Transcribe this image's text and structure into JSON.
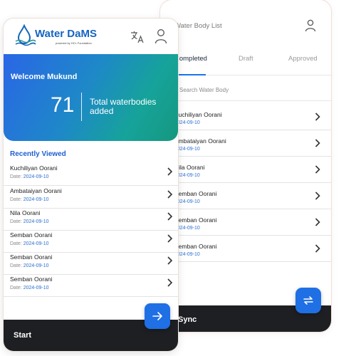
{
  "back_screen": {
    "title": "Water Body List",
    "tabs": [
      {
        "label": "Completed",
        "active": true
      },
      {
        "label": "Draft",
        "active": false
      },
      {
        "label": "Approved",
        "active": false
      }
    ],
    "search_placeholder": "Search Water Body",
    "rows": [
      {
        "name": "Kuchiliyan Oorani",
        "date": "2024-09-10"
      },
      {
        "name": "Ambataiyan Oorani",
        "date": "2024-09-10"
      },
      {
        "name": "Nila Oorani",
        "date": "2024-09-10"
      },
      {
        "name": "Semban Oorani",
        "date": "2024-09-10"
      },
      {
        "name": "Semban Oorani",
        "date": "2024-09-10"
      },
      {
        "name": "Semban Oorani",
        "date": "2024-09-10"
      }
    ],
    "footer_label": "Sync",
    "fab_icon": "sync-icon"
  },
  "front_screen": {
    "logo_title": "Water DaMS",
    "logo_subtitle": "powered by HCL Foundation",
    "welcome": "Welcome Mukund",
    "total_count": "71",
    "total_label": "Total waterbodies added",
    "recent_title": "Recently Viewed",
    "date_prefix": "Date:",
    "rows": [
      {
        "name": "Kuchiliyan Oorani",
        "date": "2024-09-10"
      },
      {
        "name": "Ambataiyan Oorani",
        "date": "2024-09-10"
      },
      {
        "name": "Nila Oorani",
        "date": "2024-09-10"
      },
      {
        "name": "Semban Oorani",
        "date": "2024-09-10"
      },
      {
        "name": "Semban Oorani",
        "date": "2024-09-10"
      },
      {
        "name": "Semban Oorani",
        "date": "2024-09-10"
      }
    ],
    "footer_label": "Start",
    "fab_icon": "arrow-right-icon"
  },
  "colors": {
    "accent": "#1f6fe5",
    "card_gradient_start": "#2a66e6",
    "card_gradient_end": "#15977f",
    "footer_bg": "#1d1f23",
    "date_blue": "#2b6fd1"
  }
}
